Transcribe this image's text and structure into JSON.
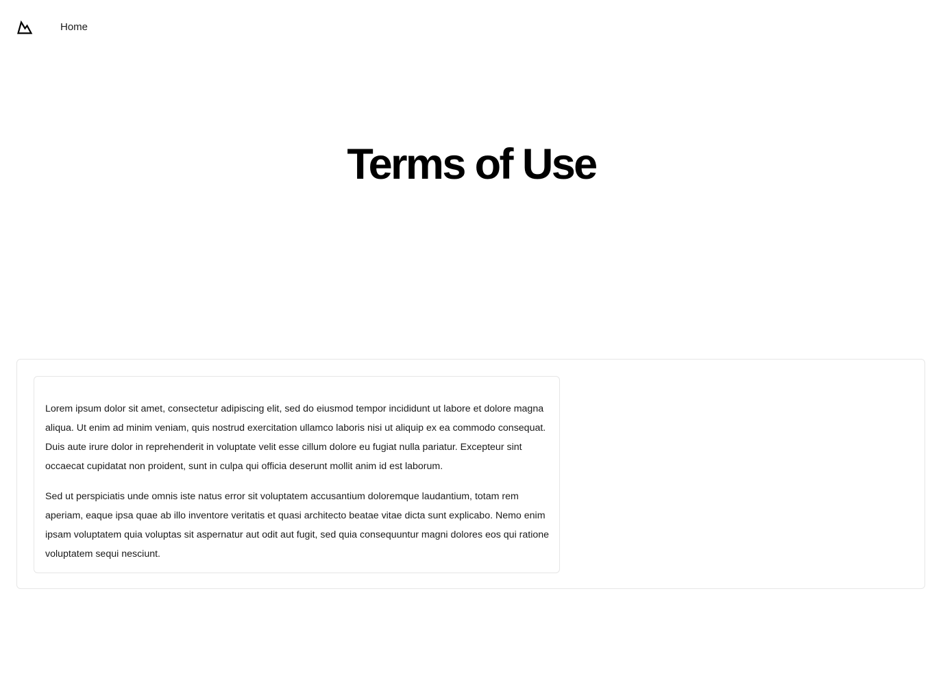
{
  "nav": {
    "logo_icon": "mountain-logo-icon",
    "home_label": "Home"
  },
  "hero": {
    "title": "Terms of Use"
  },
  "terms": {
    "paragraphs": [
      "Lorem ipsum dolor sit amet, consectetur adipiscing elit, sed do eiusmod tempor incididunt ut labore et dolore magna aliqua. Ut enim ad minim veniam, quis nostrud exercitation ullamco laboris nisi ut aliquip ex ea commodo consequat. Duis aute irure dolor in reprehenderit in voluptate velit esse cillum dolore eu fugiat nulla pariatur. Excepteur sint occaecat cupidatat non proident, sunt in culpa qui officia deserunt mollit anim id est laborum.",
      "Sed ut perspiciatis unde omnis iste natus error sit voluptatem accusantium doloremque laudantium, totam rem aperiam, eaque ipsa quae ab illo inventore veritatis et quasi architecto beatae vitae dicta sunt explicabo. Nemo enim ipsam voluptatem quia voluptas sit aspernatur aut odit aut fugit, sed quia consequuntur magni dolores eos qui ratione voluptatem sequi nesciunt."
    ]
  },
  "colors": {
    "background": "#ffffff",
    "text": "#111111",
    "border": "#e6e6e6"
  }
}
